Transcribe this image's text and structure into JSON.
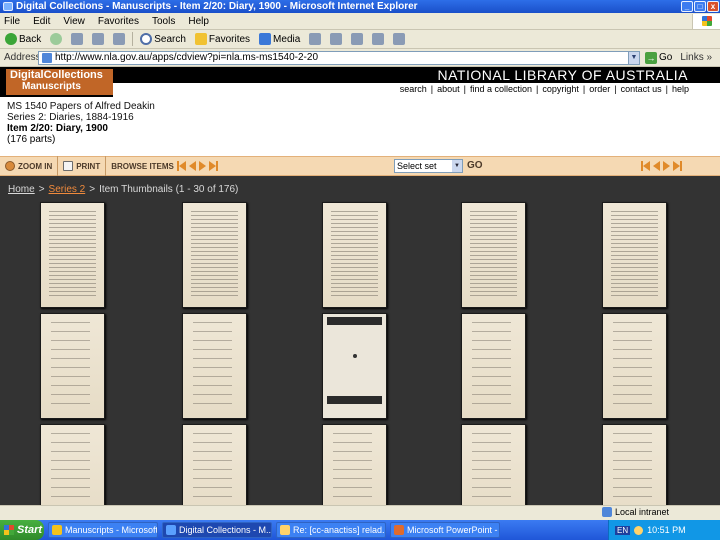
{
  "window": {
    "title": "Digital Collections - Manuscripts - Item 2/20: Diary, 1900 - Microsoft Internet Explorer",
    "controls": [
      "_",
      "□",
      "x"
    ]
  },
  "menubar": {
    "items": [
      "File",
      "Edit",
      "View",
      "Favorites",
      "Tools",
      "Help"
    ]
  },
  "toolbar": {
    "back_label": "Back",
    "search_label": "Search",
    "favorites_label": "Favorites",
    "media_label": "Media"
  },
  "addressbar": {
    "label": "Address",
    "url": "http://www.nla.gov.au/apps/cdview?pi=nla.ms-ms1540-2-20",
    "go_label": "Go",
    "links_label": "Links »"
  },
  "site": {
    "logo_line1": "DigitalCollections",
    "logo_line2": "Manuscripts",
    "library_name": "NATIONAL LIBRARY OF AUSTRALIA",
    "nav": [
      "search",
      "about",
      "find a collection",
      "copyright",
      "order",
      "contact us",
      "help"
    ]
  },
  "item": {
    "manuscript": "MS 1540 Papers of Alfred Deakin",
    "series": "Series 2: Diaries, 1884-1916",
    "title": "Item 2/20: Diary, 1900",
    "parts": "(176 parts)"
  },
  "actions": {
    "zoom_in": "ZOOM IN",
    "print": "PRINT",
    "browse_items": "BROWSE ITEMS",
    "select_set_value": "Select set",
    "go": "GO"
  },
  "breadcrumb": {
    "home": "Home",
    "series": "Series 2",
    "current": "Item Thumbnails (1 - 30 of 176)"
  },
  "thumbnails": [
    {
      "kind": "typed"
    },
    {
      "kind": "typed"
    },
    {
      "kind": "typed"
    },
    {
      "kind": "typed"
    },
    {
      "kind": "typed"
    },
    {
      "kind": "handwritten"
    },
    {
      "kind": "handwritten"
    },
    {
      "kind": "printed"
    },
    {
      "kind": "handwritten"
    },
    {
      "kind": "handwritten"
    },
    {
      "kind": "handwritten"
    },
    {
      "kind": "handwritten"
    },
    {
      "kind": "handwritten"
    },
    {
      "kind": "handwritten"
    },
    {
      "kind": "handwritten"
    }
  ],
  "statusbar": {
    "zone": "Local intranet"
  },
  "taskbar": {
    "start": "Start",
    "tasks": [
      {
        "label": "Manuscripts - Microsoft ...",
        "icon": "folder-icon",
        "active": false
      },
      {
        "label": "Digital Collections - M...",
        "icon": "ie-icon",
        "active": true
      },
      {
        "label": "Re: [cc-anactiss] relad...",
        "icon": "mail-icon",
        "active": false
      },
      {
        "label": "Microsoft PowerPoint - [...",
        "icon": "powerpoint-icon",
        "active": false
      }
    ],
    "lang": "EN",
    "clock": "10:51 PM"
  },
  "colors": {
    "accent_orange": "#c16627",
    "action_bar": "#f5d9b3",
    "gallery_bg": "#333333"
  }
}
